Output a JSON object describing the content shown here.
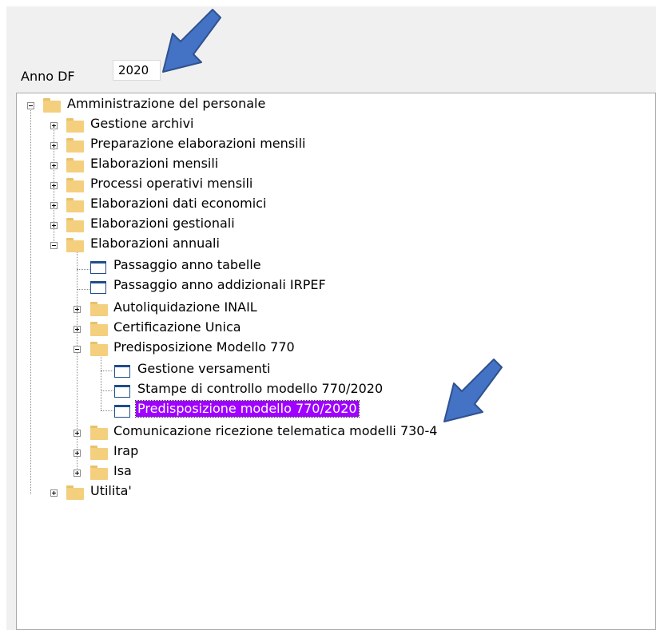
{
  "anno": {
    "label": "Anno DF",
    "value": "2020"
  },
  "tree": {
    "root": "Amministrazione del personale",
    "level1": [
      "Gestione archivi",
      "Preparazione elaborazioni mensili",
      "Elaborazioni mensili",
      "Processi operativi mensili",
      "Elaborazioni dati economici",
      "Elaborazioni gestionali",
      "Elaborazioni annuali"
    ],
    "annuali": [
      "Passaggio anno tabelle",
      "Passaggio anno addizionali IRPEF",
      "Autoliquidazione INAIL",
      "Certificazione Unica",
      "Predisposizione Modello 770"
    ],
    "modello770": [
      "Gestione versamenti",
      "Stampe di controllo modello 770/2020",
      "Predisposizione modello 770/2020"
    ],
    "annuali_after": [
      "Comunicazione ricezione telematica modelli 730-4",
      "Irap",
      "Isa"
    ],
    "last_root": "Utilita'"
  },
  "colors": {
    "selection": "#a000ff",
    "arrow": "#4472c4",
    "folder": "#f3cf7e"
  }
}
